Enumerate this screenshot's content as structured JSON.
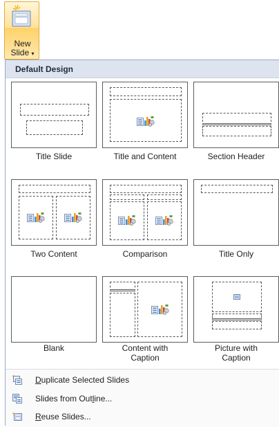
{
  "ribbon": {
    "new_slide": {
      "line1": "New",
      "line2": "Slide",
      "arrow": "▾",
      "icon": "new-slide-icon"
    }
  },
  "menu": {
    "header": "Default Design",
    "layouts": [
      {
        "name": "Title Slide"
      },
      {
        "name": "Title and Content"
      },
      {
        "name": "Section Header"
      },
      {
        "name": "Two Content"
      },
      {
        "name": "Comparison"
      },
      {
        "name": "Title Only"
      },
      {
        "name": "Blank"
      },
      {
        "name": "Content with",
        "name2": "Caption"
      },
      {
        "name": "Picture with",
        "name2": "Caption"
      }
    ],
    "commands": [
      {
        "pre": "",
        "key": "D",
        "post": "uplicate Selected Slides",
        "icon": "duplicate-slides-icon"
      },
      {
        "pre": "Slides from Out",
        "key": "l",
        "post": "ine...",
        "icon": "slides-from-outline-icon"
      },
      {
        "pre": "",
        "key": "R",
        "post": "euse Slides...",
        "icon": "reuse-slides-icon"
      }
    ]
  },
  "colors": {
    "header_bg": "#dde4ef",
    "button_gold": "#ffd26a",
    "border": "#5b5b5b"
  }
}
